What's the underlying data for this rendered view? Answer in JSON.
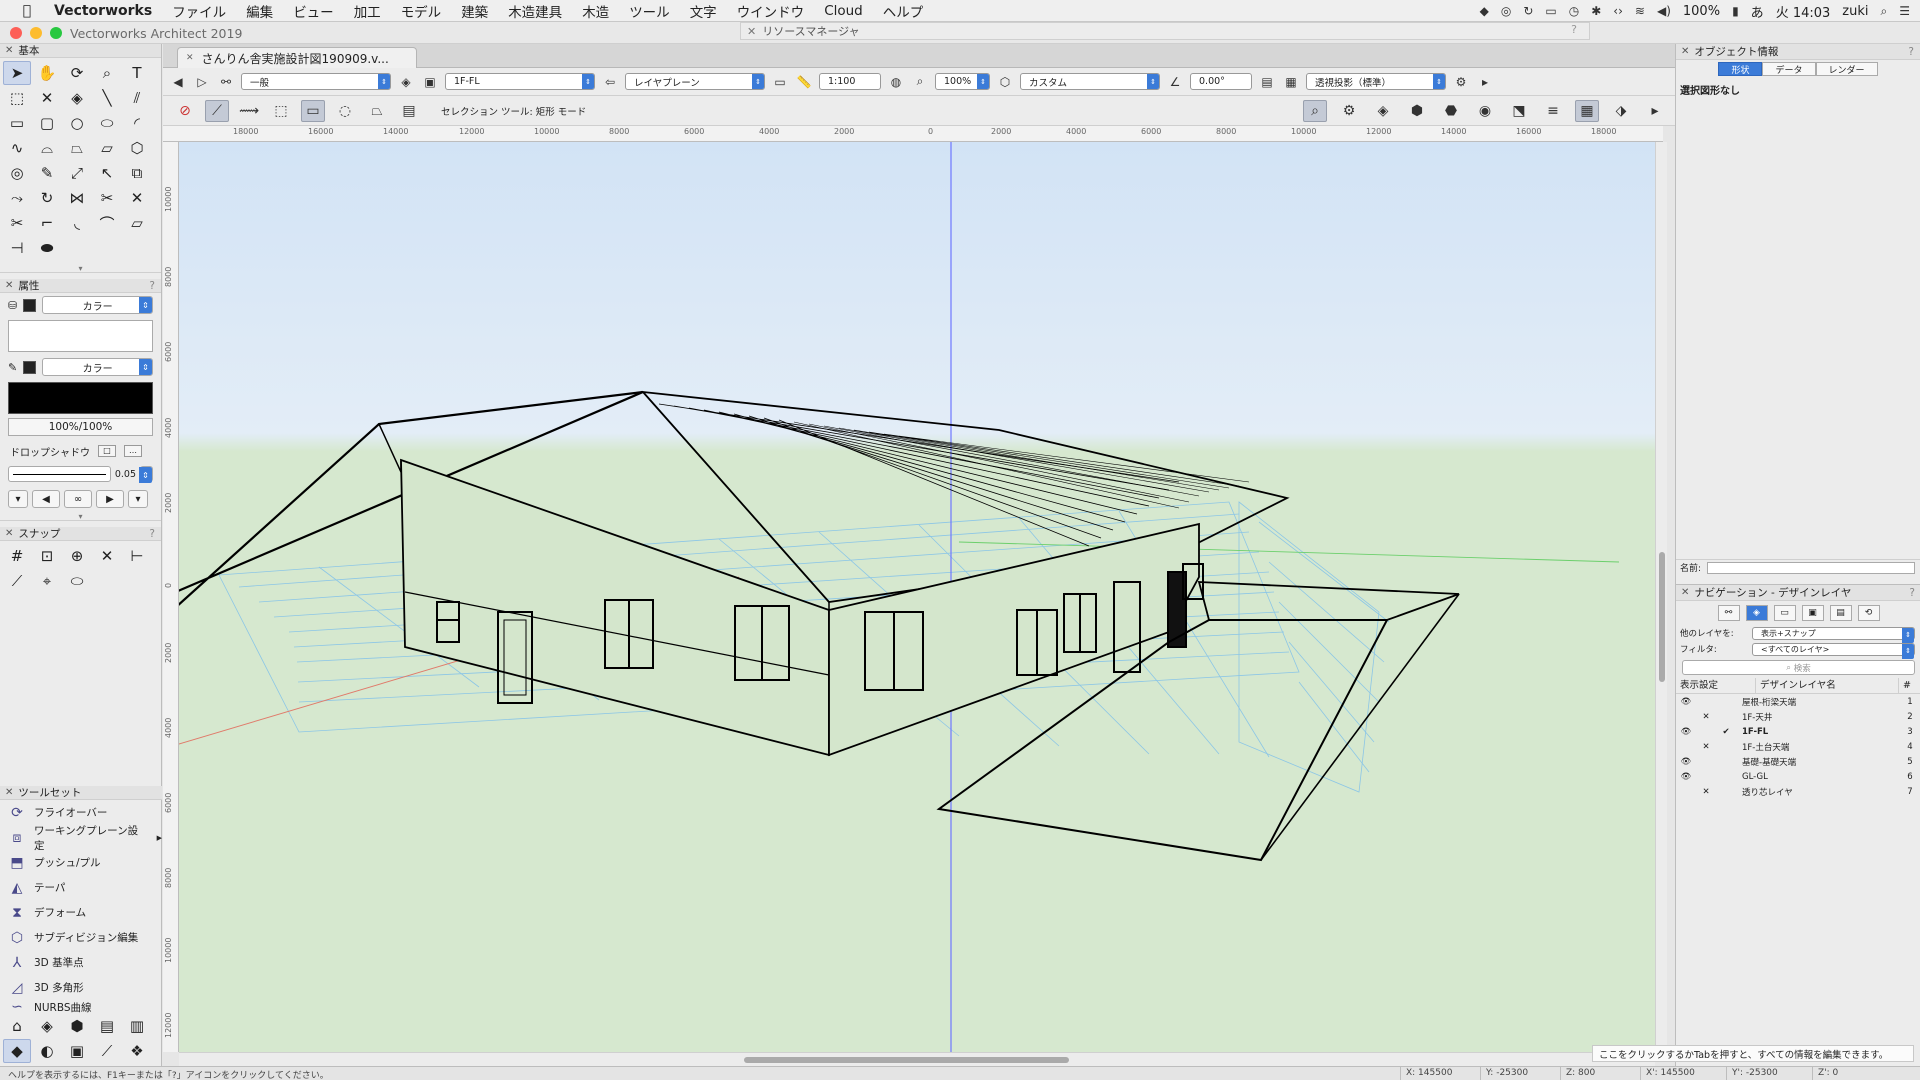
{
  "menubar": {
    "app": "Vectorworks",
    "items": [
      "ファイル",
      "編集",
      "ビュー",
      "加工",
      "モデル",
      "建築",
      "木造建具",
      "木造",
      "ツール",
      "文字",
      "ウインドウ",
      "Cloud",
      "ヘルプ"
    ],
    "battery": "100%",
    "ime": "あ",
    "clock": "火 14:03",
    "user": "zuki"
  },
  "window": {
    "title": "Vectorworks Architect 2019",
    "resource_manager": "リソースマネージャ",
    "doc_tab": "さんりん舎実施設計図190909.v..."
  },
  "view_bar": {
    "class": "一般",
    "layer": "1F-FL",
    "plane": "レイヤプレーン",
    "scale": "1:100",
    "zoom": "100%",
    "render": "カスタム",
    "angle": "0.00°",
    "projection": "透視投影（標準）"
  },
  "mode_bar": {
    "mode_text": "セレクション ツール: 矩形 モード"
  },
  "ruler": {
    "top": [
      "18000",
      "16000",
      "14000",
      "12000",
      "10000",
      "8000",
      "6000",
      "4000",
      "2000",
      "0",
      "2000",
      "4000",
      "6000",
      "8000",
      "10000",
      "12000",
      "14000",
      "16000",
      "18000"
    ],
    "left": [
      "10000",
      "8000",
      "6000",
      "4000",
      "2000",
      "0",
      "2000",
      "4000",
      "6000",
      "8000",
      "10000",
      "12000"
    ]
  },
  "left_panels": {
    "basic_title": "基本",
    "attr_title": "属性",
    "fill_label": "カラー",
    "pen_label": "カラー",
    "opacity": "100%/100%",
    "drop_shadow": "ドロップシャドウ",
    "line_weight": "0.05",
    "snap_title": "スナップ",
    "toolset_title": "ツールセット",
    "toolset_items": [
      {
        "label": "フライオーバー",
        "icon": "flyover-icon"
      },
      {
        "label": "ワーキングプレーン設定",
        "icon": "working-plane-icon"
      },
      {
        "label": "プッシュ/プル",
        "icon": "push-pull-icon"
      },
      {
        "label": "テーパ",
        "icon": "taper-icon"
      },
      {
        "label": "デフォーム",
        "icon": "deform-icon"
      },
      {
        "label": "サブディビジョン編集",
        "icon": "subdivision-icon"
      },
      {
        "label": "3D 基準点",
        "icon": "3d-locus-icon"
      },
      {
        "label": "3D 多角形",
        "icon": "3d-polygon-icon"
      },
      {
        "label": "NURBS曲線",
        "icon": "nurbs-icon"
      }
    ]
  },
  "oip": {
    "title": "オブジェクト情報",
    "tabs": [
      "形状",
      "データ",
      "レンダー"
    ],
    "no_selection": "選択図形なし",
    "name_label": "名前:"
  },
  "navigation": {
    "title": "ナビゲーション - デザインレイヤ",
    "other_layers_label": "他のレイヤを:",
    "other_layers_value": "表示+スナップ",
    "filter_label": "フィルタ:",
    "filter_value": "<すべてのレイヤ>",
    "search_placeholder": "検索",
    "col_visibility": "表示設定",
    "col_name": "デザインレイヤ名",
    "col_num": "#",
    "layers": [
      {
        "vis": "eye",
        "mark": "",
        "name": "屋根-桁梁天端",
        "num": "1",
        "active": false
      },
      {
        "vis": "x",
        "mark": "",
        "name": "1F-天井",
        "num": "2",
        "active": false
      },
      {
        "vis": "eye",
        "mark": "✔",
        "name": "1F-FL",
        "num": "3",
        "active": true
      },
      {
        "vis": "x",
        "mark": "",
        "name": "1F-土台天端",
        "num": "4",
        "active": false
      },
      {
        "vis": "eye",
        "mark": "",
        "name": "基礎-基礎天端",
        "num": "5",
        "active": false
      },
      {
        "vis": "eye",
        "mark": "",
        "name": "GL-GL",
        "num": "6",
        "active": false
      },
      {
        "vis": "x",
        "mark": "",
        "name": "透り芯レイヤ",
        "num": "7",
        "active": false
      }
    ]
  },
  "status": {
    "help": "ヘルプを表示するには、F1キーまたは「?」アイコンをクリックしてください。",
    "tip": "ここをクリックするかTabを押すと、すべての情報を編集できます。",
    "coords": [
      {
        "label": "X: 145500"
      },
      {
        "label": "Y: -25300"
      },
      {
        "label": "Z: 800"
      },
      {
        "label": "X': 145500"
      },
      {
        "label": "Y': -25300"
      },
      {
        "label": "Z': 0"
      }
    ]
  },
  "colors": {
    "accent": "#3b7bd8",
    "sky": "#d2e3f5",
    "ground": "#d6e8cf",
    "grid": "#8cc6e6",
    "axis_z": "#6f78ff",
    "axis_x": "#e07a6a",
    "axis_y": "#6ccf6c"
  }
}
